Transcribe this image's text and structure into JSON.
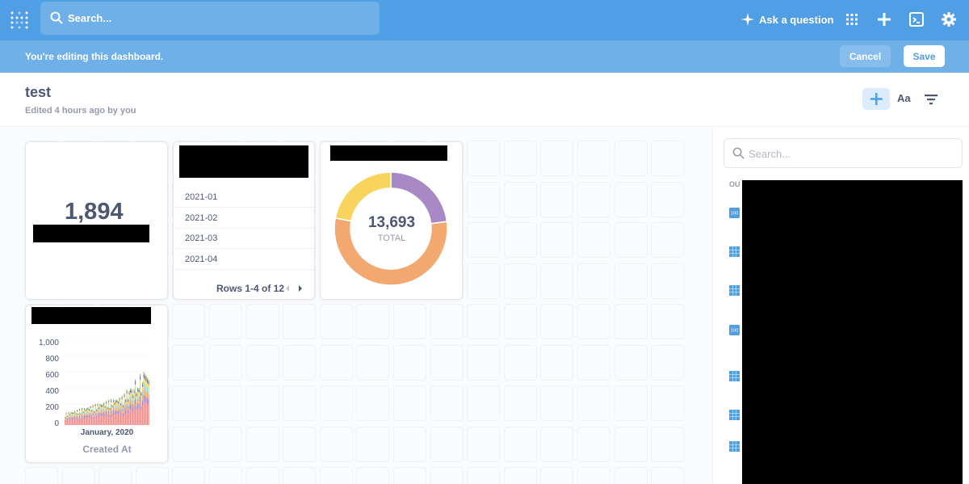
{
  "topnav": {
    "search_placeholder": "Search...",
    "ask_label": "Ask a question",
    "color": "#509ee3"
  },
  "editbar": {
    "message": "You're editing this dashboard.",
    "cancel_label": "Cancel",
    "save_label": "Save"
  },
  "header": {
    "title": "test",
    "subtitle": "Edited 4 hours ago by you",
    "text_button": "Aa"
  },
  "cards": {
    "scalar": {
      "value": "1,894"
    },
    "table": {
      "rows": [
        "2021-01",
        "2021-02",
        "2021-03",
        "2021-04"
      ],
      "footer": "Rows 1-4 of 12"
    },
    "donut": {
      "total": "13,693",
      "total_label": "TOTAL",
      "segments": [
        {
          "value": 0.23,
          "color": "#a989c5"
        },
        {
          "value": 0.55,
          "color": "#f2a86f"
        },
        {
          "value": 0.22,
          "color": "#f9d45c"
        }
      ]
    },
    "bar": {
      "y_ticks": [
        "1,000",
        "800",
        "600",
        "400",
        "200",
        "0"
      ],
      "x_label": "January, 2020",
      "x_title": "Created At"
    }
  },
  "sidebar": {
    "search_placeholder": "Search...",
    "section_label": "OU",
    "icon_badge": "100"
  }
}
